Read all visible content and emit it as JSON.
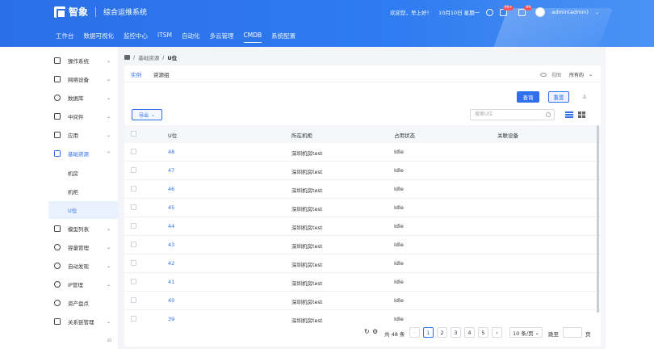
{
  "header": {
    "logo_text": "智象",
    "system_title": "综合运维系统",
    "greeting": "欢迎您，早上好！",
    "date": "10月10日 星期一",
    "badges": [
      "99+",
      "99"
    ],
    "user": "admin(admin)"
  },
  "nav": [
    "工作台",
    "数据可视化",
    "监控中心",
    "ITSM",
    "自动化",
    "多云管理",
    "CMDB",
    "系统配置"
  ],
  "nav_active": "CMDB",
  "sidebar": {
    "items": [
      {
        "label": "操作系统",
        "icon": "monitor-icon"
      },
      {
        "label": "网络设备",
        "icon": "network-icon"
      },
      {
        "label": "数据库",
        "icon": "database-icon"
      },
      {
        "label": "中间件",
        "icon": "middleware-icon"
      },
      {
        "label": "应用",
        "icon": "apps-icon"
      },
      {
        "label": "基础资源",
        "icon": "grid-icon"
      },
      {
        "label": "机房"
      },
      {
        "label": "机柜"
      },
      {
        "label": "U位"
      },
      {
        "label": "模型列表",
        "icon": "list-icon"
      },
      {
        "label": "容量管理",
        "icon": "capacity-icon"
      },
      {
        "label": "自动发现",
        "icon": "discover-icon"
      },
      {
        "label": "IP管理",
        "icon": "ip-icon"
      },
      {
        "label": "资产盘点",
        "icon": "inventory-icon"
      },
      {
        "label": "关系链管理",
        "icon": "relation-icon"
      }
    ]
  },
  "breadcrumb": [
    "基础资源",
    "U位"
  ],
  "tabs": [
    "实例",
    "资源组"
  ],
  "view": {
    "label": "视图",
    "scope": "所有的"
  },
  "buttons": {
    "query": "查询",
    "reset": "重置",
    "export": "导出"
  },
  "search": {
    "placeholder": "搜索U位"
  },
  "table": {
    "columns": [
      "U位",
      "所在机柜",
      "占用状态",
      "关联设备"
    ],
    "rows": [
      {
        "u": "48",
        "cabinet": "深圳机房test",
        "status": "Idle",
        "device": ""
      },
      {
        "u": "47",
        "cabinet": "深圳机房test",
        "status": "Idle",
        "device": ""
      },
      {
        "u": "46",
        "cabinet": "深圳机房test",
        "status": "Idle",
        "device": ""
      },
      {
        "u": "45",
        "cabinet": "深圳机房test",
        "status": "Idle",
        "device": ""
      },
      {
        "u": "44",
        "cabinet": "深圳机房test",
        "status": "Idle",
        "device": ""
      },
      {
        "u": "43",
        "cabinet": "深圳机房test",
        "status": "Idle",
        "device": ""
      },
      {
        "u": "42",
        "cabinet": "深圳机房test",
        "status": "Idle",
        "device": ""
      },
      {
        "u": "41",
        "cabinet": "深圳机房test",
        "status": "Idle",
        "device": ""
      },
      {
        "u": "40",
        "cabinet": "深圳机房test",
        "status": "Idle",
        "device": ""
      },
      {
        "u": "39",
        "cabinet": "深圳机房test",
        "status": "Idle",
        "device": ""
      }
    ]
  },
  "pagination": {
    "total": "共 48 条",
    "pages": [
      "1",
      "2",
      "3",
      "4",
      "5"
    ],
    "current": "1",
    "page_size": "10 条/页",
    "jump_label": "跳至",
    "jump_suffix": "页"
  },
  "colors": {
    "primary": "#2f6fec",
    "header": "#2a6fe6"
  }
}
